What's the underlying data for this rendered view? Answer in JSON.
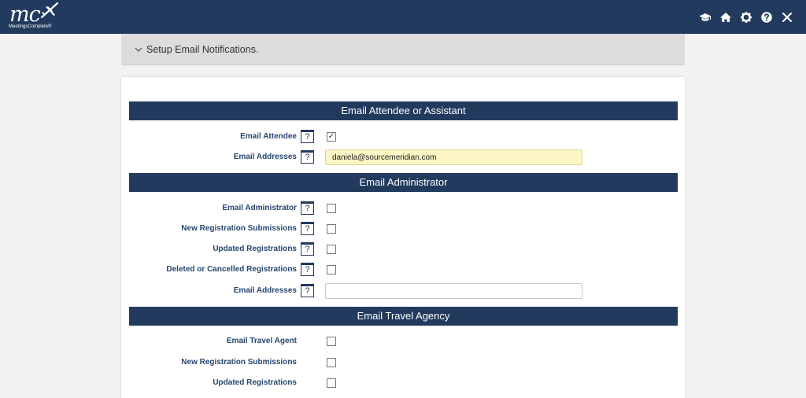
{
  "app": {
    "logo_text": "mc",
    "logo_subtitle": "MeetingsComplete®"
  },
  "topbar": {
    "icons": [
      "graduation-cap-icon",
      "home-icon",
      "gear-icon",
      "help-icon",
      "close-icon"
    ]
  },
  "setup": {
    "label": "Setup Email Notifications."
  },
  "sections": {
    "attendee": {
      "title": "Email Attendee or Assistant",
      "email_attendee_label": "Email Attendee",
      "email_attendee_checked": true,
      "email_addresses_label": "Email Addresses",
      "email_addresses_value": "daniela@sourcemeridian.com"
    },
    "administrator": {
      "title": "Email Administrator",
      "email_administrator_label": "Email Administrator",
      "new_registration_label": "New Registration Submissions",
      "updated_registrations_label": "Updated Registrations",
      "deleted_registrations_label": "Deleted or Cancelled Registrations",
      "email_addresses_label": "Email Addresses",
      "email_addresses_value": ""
    },
    "travel": {
      "title": "Email Travel Agency",
      "email_travel_agent_label": "Email Travel Agent",
      "new_registration_label": "New Registration Submissions",
      "updated_registrations_label": "Updated Registrations"
    }
  },
  "help_glyph": "?",
  "check_glyph": "✓"
}
